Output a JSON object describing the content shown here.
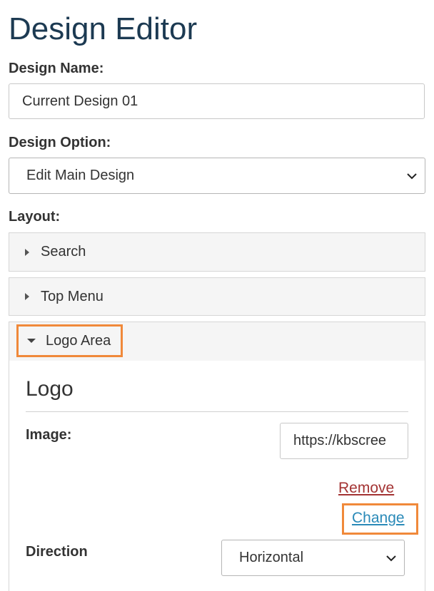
{
  "page": {
    "title": "Design Editor"
  },
  "design_name": {
    "label": "Design Name:",
    "value": "Current Design 01"
  },
  "design_option": {
    "label": "Design Option:",
    "selected": "Edit Main Design"
  },
  "layout": {
    "label": "Layout:",
    "sections": [
      {
        "label": "Search",
        "expanded": false
      },
      {
        "label": "Top Menu",
        "expanded": false
      },
      {
        "label": "Logo Area",
        "expanded": true
      }
    ]
  },
  "logo_panel": {
    "title": "Logo",
    "image_label": "Image:",
    "image_value": "https://kbscree",
    "remove_label": "Remove",
    "change_label": "Change",
    "direction_label": "Direction",
    "direction_selected": "Horizontal"
  },
  "colors": {
    "title": "#1c3a52",
    "highlight": "#f0893a",
    "remove_link": "#a33333",
    "change_link": "#2a8ab8"
  }
}
